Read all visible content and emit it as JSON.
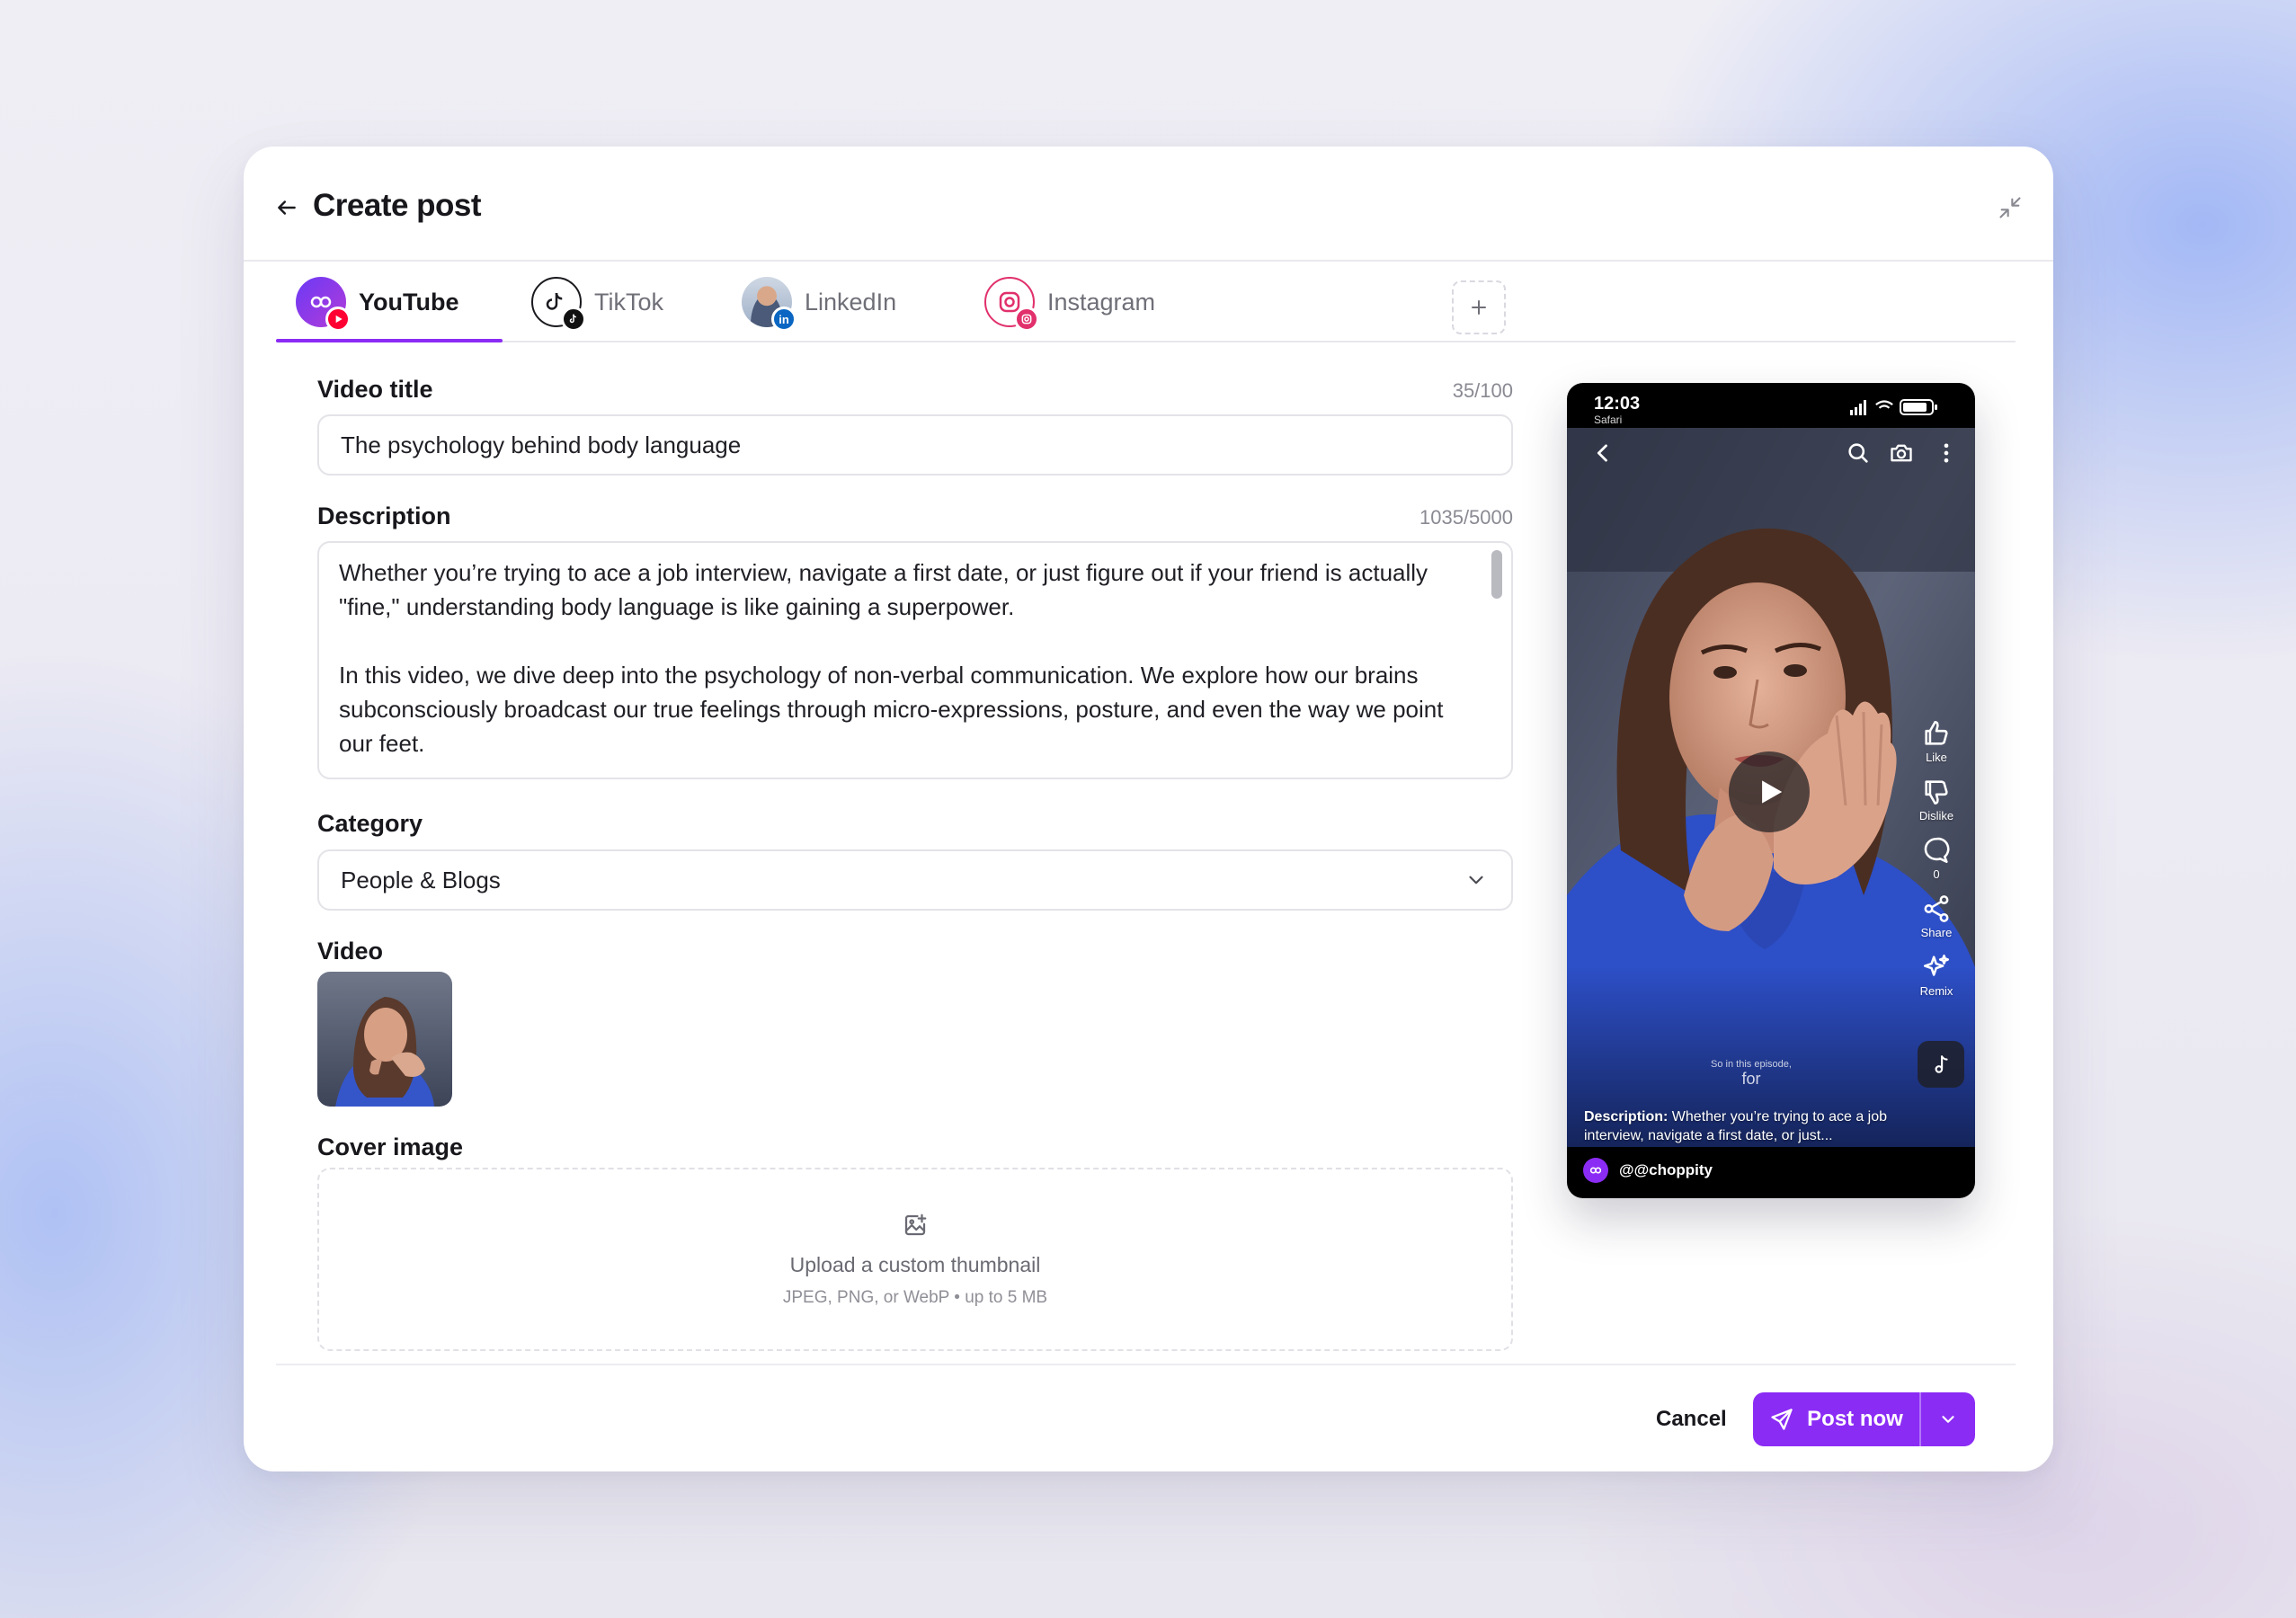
{
  "header": {
    "title": "Create post"
  },
  "tabs": [
    {
      "label": "YouTube",
      "active": true
    },
    {
      "label": "TikTok",
      "active": false
    },
    {
      "label": "LinkedIn",
      "active": false
    },
    {
      "label": "Instagram",
      "active": false
    }
  ],
  "form": {
    "title_label": "Video title",
    "title_counter": "35/100",
    "title_value": "The psychology behind body language",
    "description_label": "Description",
    "description_counter": "1035/5000",
    "description_p1": "Whether you’re trying to ace a job interview, navigate a first date, or just figure out if your friend is actually \"fine,\" understanding body language is like gaining a superpower.",
    "description_p2": "In this video, we dive deep into the psychology of non-verbal communication. We explore how our brains subconsciously broadcast our true feelings through micro-expressions, posture, and even the way we point our feet.",
    "category_label": "Category",
    "category_value": "People & Blogs",
    "video_label": "Video",
    "cover_label": "Cover image",
    "upload_title": "Upload a custom thumbnail",
    "upload_hint": "JPEG, PNG, or WebP • up to 5 MB"
  },
  "footer": {
    "cancel_label": "Cancel",
    "post_label": "Post now"
  },
  "preview": {
    "time": "12:03",
    "app": "Safari",
    "actions": {
      "like": "Like",
      "dislike": "Dislike",
      "comments": "0",
      "share": "Share",
      "remix": "Remix"
    },
    "subtitle_small": "So in this episode,",
    "subtitle_big": "for",
    "desc_prefix": "Description:",
    "desc_text": " Whether you’re trying to ace a job interview, navigate a first date, or just...",
    "channel": "@@choppity"
  },
  "colors": {
    "accent": "#8b2cf5",
    "youtube": "#ff0033",
    "linkedin": "#0a66c2",
    "instagram": "#e1306c"
  }
}
